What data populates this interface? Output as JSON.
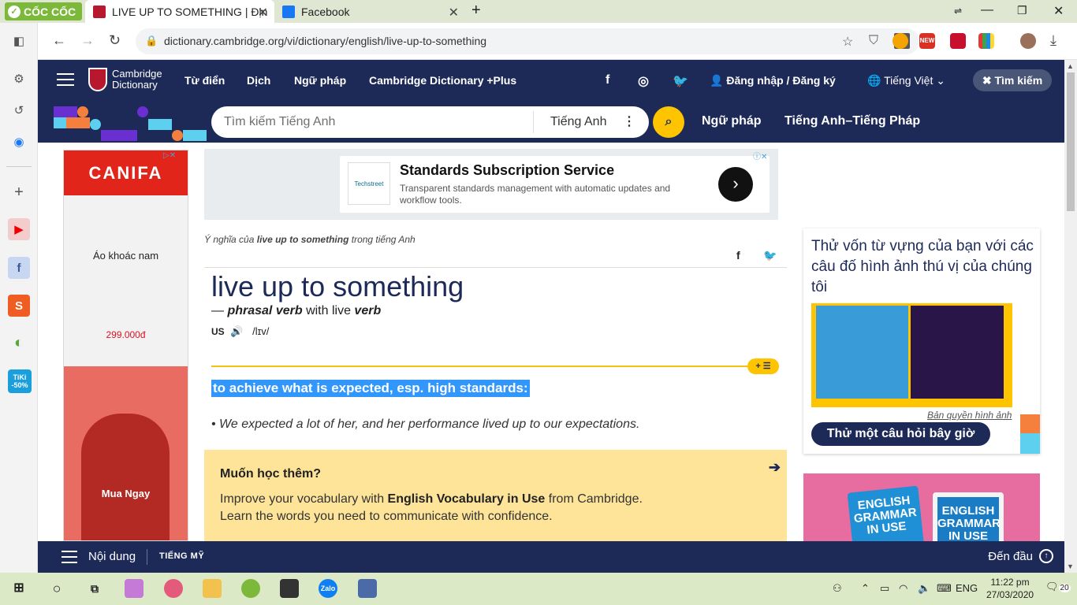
{
  "browser": {
    "brand": "CỐC CỐC",
    "tabs": [
      {
        "title": "LIVE UP TO SOMETHING | Địn",
        "active": true
      },
      {
        "title": "Facebook",
        "active": false
      }
    ],
    "new_tab": "+",
    "url": "dictionary.cambridge.org/vi/dictionary/english/live-up-to-something",
    "extensions": [
      "coccoc-icon",
      "new-badge-icon",
      "red-extension-icon",
      "color-grid-icon",
      "profile-avatar"
    ],
    "ext_new_label": "NEW",
    "left_sidebar": [
      "sidebar-toggle-icon",
      "settings-icon",
      "history-icon",
      "messenger-icon",
      "add-icon",
      "youtube-icon",
      "facebook-icon",
      "shopee-icon",
      "coccoc-green-icon",
      "tiki-icon"
    ],
    "tiki_label": "TiKi -50%"
  },
  "header": {
    "logo_line1": "Cambridge",
    "logo_line2": "Dictionary",
    "nav": [
      "Từ điển",
      "Dịch",
      "Ngữ pháp",
      "Cambridge Dictionary +Plus"
    ],
    "login": "Đăng nhập / Đăng ký",
    "language": "Tiếng Việt",
    "search_pill": "Tìm kiếm"
  },
  "searchbar": {
    "placeholder": "Tìm kiếm Tiếng Anh",
    "dictionary": "Tiếng Anh",
    "links": [
      "Ngữ pháp",
      "Tiếng Anh–Tiếng Pháp"
    ]
  },
  "left_ad": {
    "brand": "CANIFA",
    "product": "Áo khoác nam",
    "price": "299.000đ",
    "cta": "Mua Ngay"
  },
  "banner_ad": {
    "logo": "Techstreet",
    "title": "Standards Subscription Service",
    "description": "Transparent standards management with automatic updates and workflow tools."
  },
  "entry": {
    "meaning_prefix": "Ý nghĩa của",
    "meaning_word": "live up to something",
    "meaning_suffix": "trong tiếng Anh",
    "headword": "live up to something",
    "pos_dash": "—",
    "pos": "phrasal verb",
    "with_text": "with live",
    "base_pos": "verb",
    "region": "US",
    "ipa": "/lɪv/",
    "definition": "to achieve what is expected, esp. high standards:",
    "example": "We expected a lot of her, and her performance lived up to our expectations."
  },
  "learn_more": {
    "heading": "Muốn học thêm?",
    "line1_prefix": "Improve your vocabulary with",
    "line1_book": "English Vocabulary in Use",
    "line1_suffix": "from Cambridge.",
    "line2": "Learn the words you need to communicate with confidence."
  },
  "quiz": {
    "title": "Thử vốn từ vựng của bạn với các câu đố hình ảnh thú vị của chúng tôi",
    "credit": "Bản quyền hình ảnh",
    "button": "Thử một câu hỏi bây giờ"
  },
  "book_ad": {
    "book1": "ENGLISH GRAMMAR IN USE",
    "book2": "ENGLISH GRAMMAR IN USE ebook"
  },
  "bottom_bar": {
    "contents": "Nội dung",
    "region": "TIẾNG MỸ",
    "to_top": "Đến đầu"
  },
  "taskbar": {
    "zalo": "Zalo",
    "language": "ENG",
    "time": "11:22 pm",
    "date": "27/03/2020",
    "notifications": "20"
  }
}
